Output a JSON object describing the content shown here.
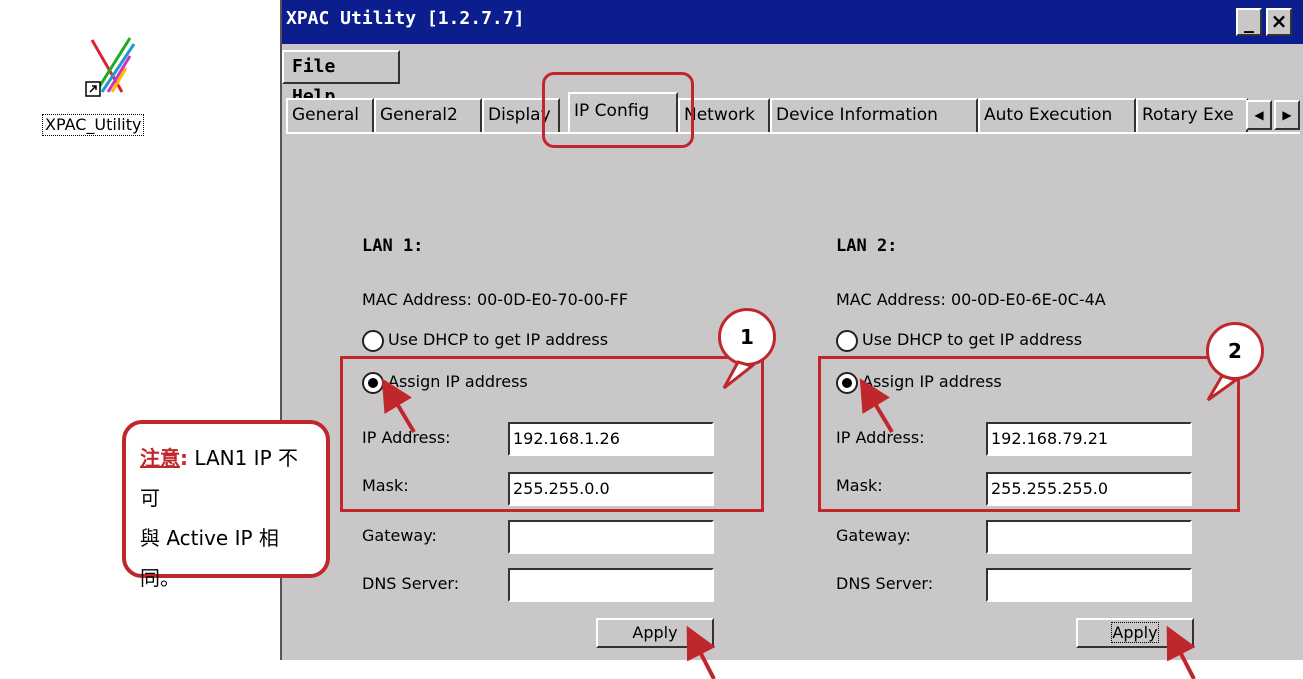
{
  "desktop_icon": {
    "label": "XPAC_Utility"
  },
  "window": {
    "title": "XPAC Utility  [1.2.7.7]",
    "minimize_glyph": "_",
    "close_glyph": "×"
  },
  "menu": {
    "file": "File",
    "help": "Help"
  },
  "tabs": [
    {
      "label": "General"
    },
    {
      "label": "General2"
    },
    {
      "label": "Display"
    },
    {
      "label": "IP Config"
    },
    {
      "label": "Network"
    },
    {
      "label": "Device Information"
    },
    {
      "label": "Auto Execution"
    },
    {
      "label": "Rotary Exe"
    }
  ],
  "active_tab": "IP Config",
  "lan1": {
    "title": "LAN 1:",
    "mac_label": "MAC Address:",
    "mac": "00-0D-E0-70-00-FF",
    "dhcp_label": "Use DHCP to get IP address",
    "assign_label": "Assign IP address",
    "selected": "assign",
    "ip_label": "IP Address:",
    "ip": "192.168.1.26",
    "mask_label": "Mask:",
    "mask": "255.255.0.0",
    "gateway_label": "Gateway:",
    "gateway": "",
    "dns_label": "DNS Server:",
    "dns": "",
    "apply": "Apply"
  },
  "lan2": {
    "title": "LAN 2:",
    "mac_label": "MAC Address:",
    "mac": "00-0D-E0-6E-0C-4A",
    "dhcp_label": "Use DHCP to get IP address",
    "assign_label": "Assign IP address",
    "selected": "assign",
    "ip_label": "IP Address:",
    "ip": "192.168.79.21",
    "mask_label": "Mask:",
    "mask": "255.255.255.0",
    "gateway_label": "Gateway:",
    "gateway": "",
    "dns_label": "DNS Server:",
    "dns": "",
    "apply": "Apply"
  },
  "annotations": {
    "step1": "1",
    "step2": "2",
    "note_warn": "注意",
    "note_colon": ":",
    "note_line1": " LAN1 IP 不可",
    "note_line2": "與 Active IP 相同。",
    "color": "#c0272d"
  }
}
